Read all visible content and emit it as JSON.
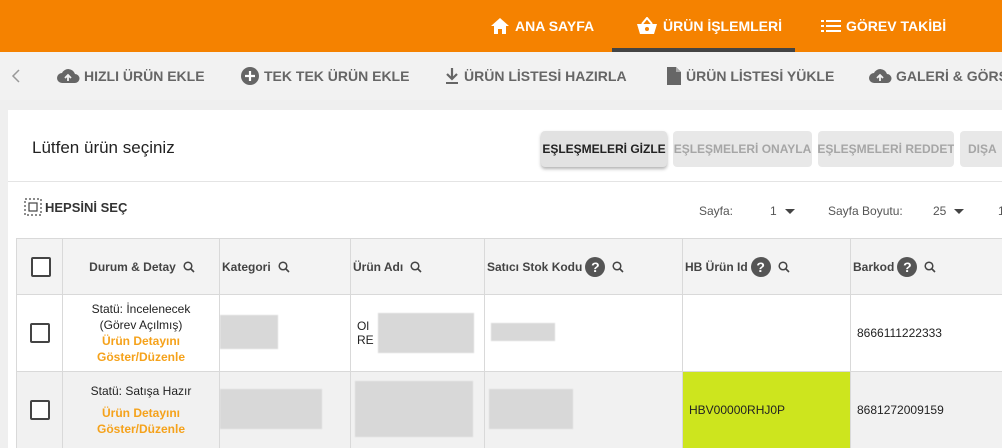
{
  "topnav": {
    "items": [
      {
        "label": "ANA SAYFA",
        "icon": "home-icon"
      },
      {
        "label": "ÜRÜN İŞLEMLERİ",
        "icon": "basket-icon",
        "active": true
      },
      {
        "label": "GÖREV TAKİBİ",
        "icon": "list-icon"
      }
    ]
  },
  "subnav": {
    "items": [
      {
        "label": "HIZLI ÜRÜN EKLE",
        "icon": "cloud-upload-icon"
      },
      {
        "label": "TEK TEK ÜRÜN EKLE",
        "icon": "plus-circle-icon"
      },
      {
        "label": "ÜRÜN LİSTESİ HAZIRLA",
        "icon": "download-icon"
      },
      {
        "label": "ÜRÜN LİSTESİ YÜKLE",
        "icon": "file-icon"
      },
      {
        "label": "GALERİ & GÖRSE",
        "icon": "cloud-upload-icon"
      }
    ]
  },
  "panel": {
    "title": "Lütfen ürün seçiniz",
    "buttons": [
      {
        "label": "EŞLEŞMELERİ GİZLE",
        "enabled": true
      },
      {
        "label": "EŞLEŞMELERİ ONAYLA",
        "enabled": false
      },
      {
        "label": "EŞLEŞMELERİ REDDET",
        "enabled": false
      },
      {
        "label": "DIŞA",
        "enabled": false
      }
    ],
    "select_all": "HEPSİNİ SEÇ",
    "pager": {
      "page_label": "Sayfa:",
      "page_value": "1",
      "size_label": "Sayfa Boyutu:",
      "size_value": "25",
      "overflow": "1"
    }
  },
  "table": {
    "columns": [
      "Durum & Detay",
      "Kategori",
      "Ürün Adı",
      "Satıcı Stok Kodu",
      "HB Ürün Id",
      "Barkod"
    ],
    "rows": [
      {
        "status": "Statü: İncelenecek",
        "status_sub": "(Görev Açılmış)",
        "link": "Ürün Detayını Göster/Düzenle",
        "name_line1": "Ol",
        "name_line2": "RE",
        "hb_id": "",
        "barcode": "8666111222333"
      },
      {
        "status": "Statü: Satışa Hazır",
        "status_sub": "",
        "link": "Ürün Detayını Göster/Düzenle",
        "name_line1": "",
        "name_line2": "",
        "hb_id": "HBV00000RHJ0P",
        "barcode": "8681272009159"
      }
    ]
  },
  "colors": {
    "brand": "#f58200",
    "link": "#f5a21b",
    "highlight": "#cde51e"
  }
}
